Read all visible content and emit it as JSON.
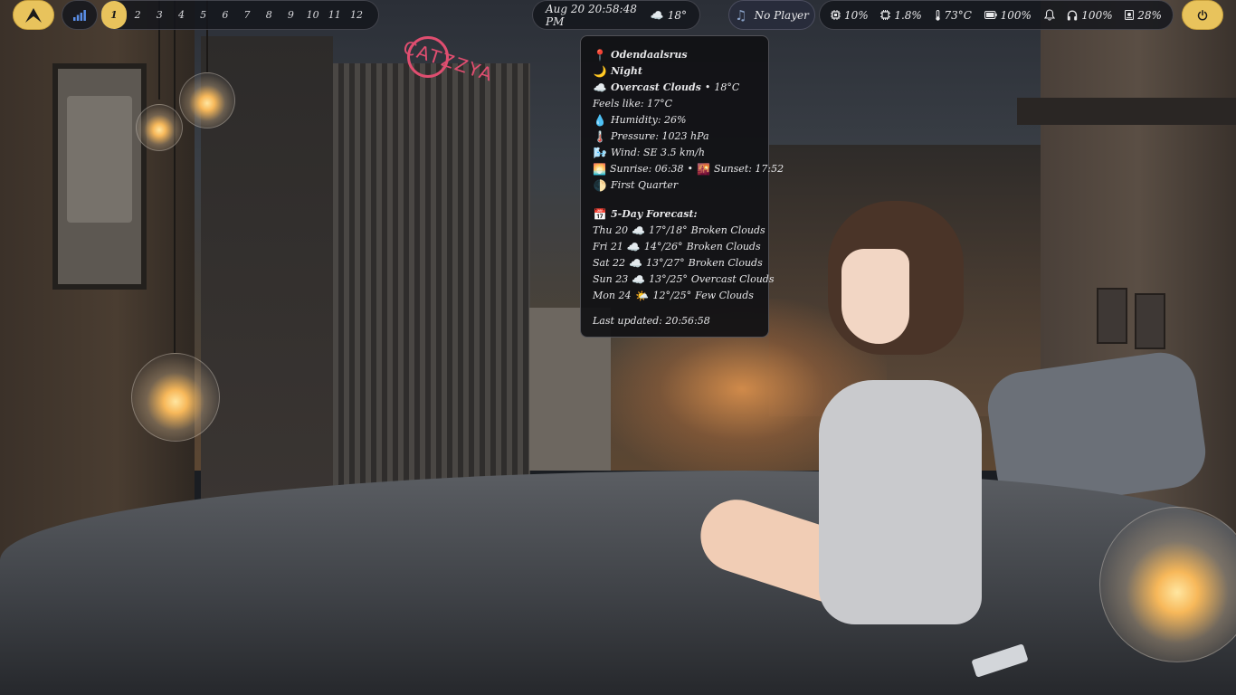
{
  "topbar": {
    "launcher_icon": "arch-logo-icon",
    "network_icon": "signal-bars-icon",
    "workspaces": [
      "1",
      "2",
      "3",
      "4",
      "5",
      "6",
      "7",
      "8",
      "9",
      "10",
      "11",
      "12"
    ],
    "active_workspace": "1",
    "clock": {
      "datetime": "Aug 20 20:58:48 PM",
      "weather_icon": "☁️",
      "temperature": "18°"
    },
    "player": {
      "icon": "♫",
      "label": "No Player"
    },
    "stats": {
      "cpu": "10%",
      "memory": "1.8%",
      "temperature": "73°C",
      "battery": "100%",
      "notifications_icon": "bell-icon",
      "volume": "100%",
      "disk": "28%"
    },
    "power_icon": "power-icon"
  },
  "weather": {
    "location": "Odendaalsrus",
    "time_of_day": "Night",
    "condition": "Overcast Clouds",
    "condition_bullet": "•",
    "temperature": "18°C",
    "feels_like": "Feels like: 17°C",
    "humidity": "Humidity: 26%",
    "pressure": "Pressure: 1023 hPa",
    "wind": "Wind: SE 3.5 km/h",
    "sunrise": "Sunrise: 06:38",
    "sun_bullet": "•",
    "sunset": "Sunset: 17:52",
    "moon_phase": "First Quarter",
    "forecast_title": "5-Day Forecast:",
    "forecast": [
      {
        "day": "Thu 20",
        "icon": "☁️",
        "range": "17°/18°",
        "desc": "Broken Clouds"
      },
      {
        "day": "Fri 21",
        "icon": "☁️",
        "range": "14°/26°",
        "desc": "Broken Clouds"
      },
      {
        "day": "Sat 22",
        "icon": "☁️",
        "range": "13°/27°",
        "desc": "Broken Clouds"
      },
      {
        "day": "Sun 23",
        "icon": "☁️",
        "range": "13°/25°",
        "desc": "Overcast Clouds"
      },
      {
        "day": "Mon 24",
        "icon": "🌤️",
        "range": "12°/25°",
        "desc": "Few Clouds"
      }
    ],
    "last_updated": "Last updated: 20:56:58"
  },
  "wallpaper": {
    "sign_text": "CATZZYA"
  }
}
